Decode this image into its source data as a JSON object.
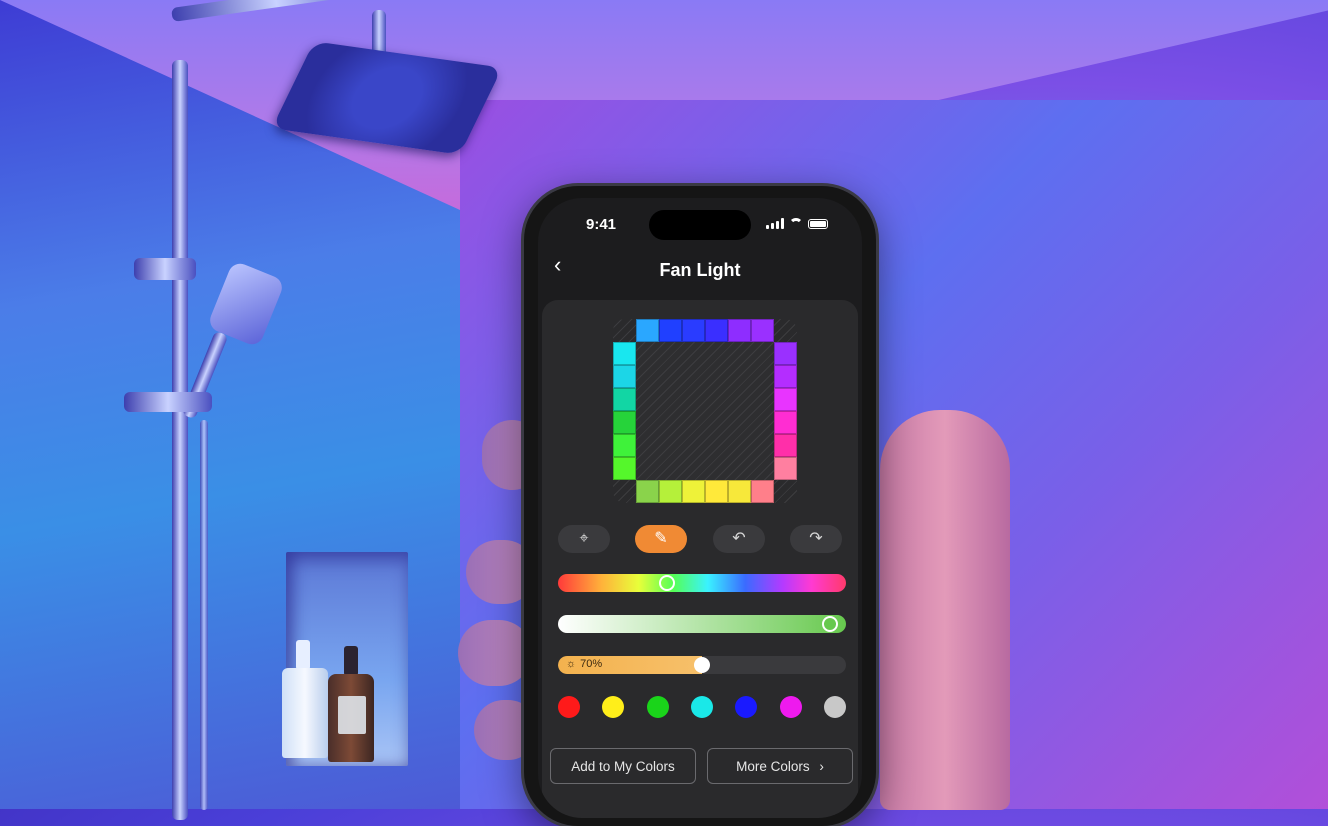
{
  "status_bar": {
    "time": "9:41"
  },
  "nav": {
    "back_glyph": "‹",
    "title": "Fan Light"
  },
  "led_grid": {
    "top_row": [
      "#2aa7ff",
      "#2040ff",
      "#2a3cff",
      "#3a2fff",
      "#8e2dff",
      "#9a30ff"
    ],
    "right_col": [
      "#9a30ff",
      "#b42dff",
      "#e834ff",
      "#ff2dd2",
      "#ff2fa9",
      "#ff7fa0"
    ],
    "bottom_row": [
      "#8ad34b",
      "#b5f03a",
      "#eef239",
      "#ffe93a",
      "#f7e83a",
      "#ff7f8a"
    ],
    "left_col": [
      "#19e7ef",
      "#1cd6e7",
      "#12d6a4",
      "#26d33a",
      "#3ff23a",
      "#55f72b"
    ]
  },
  "tools": [
    {
      "name": "select-tool",
      "glyph": "⌖",
      "active": false
    },
    {
      "name": "brush-tool",
      "glyph": "✎",
      "active": true
    },
    {
      "name": "undo-tool",
      "glyph": "↶",
      "active": false
    },
    {
      "name": "redo-tool",
      "glyph": "↷",
      "active": false
    }
  ],
  "sliders": {
    "hue_position": 0.37,
    "saturation_position": 0.97,
    "brightness_label": "70%",
    "brightness_value": 0.5
  },
  "preset_colors": [
    "#ff1a1a",
    "#ffee1a",
    "#1ad41a",
    "#1ae8e8",
    "#1a1aff",
    "#ee1aee",
    "#c8c8c8"
  ],
  "buttons": {
    "add_label": "Add to My Colors",
    "more_label": "More Colors",
    "more_chevron": "›"
  }
}
